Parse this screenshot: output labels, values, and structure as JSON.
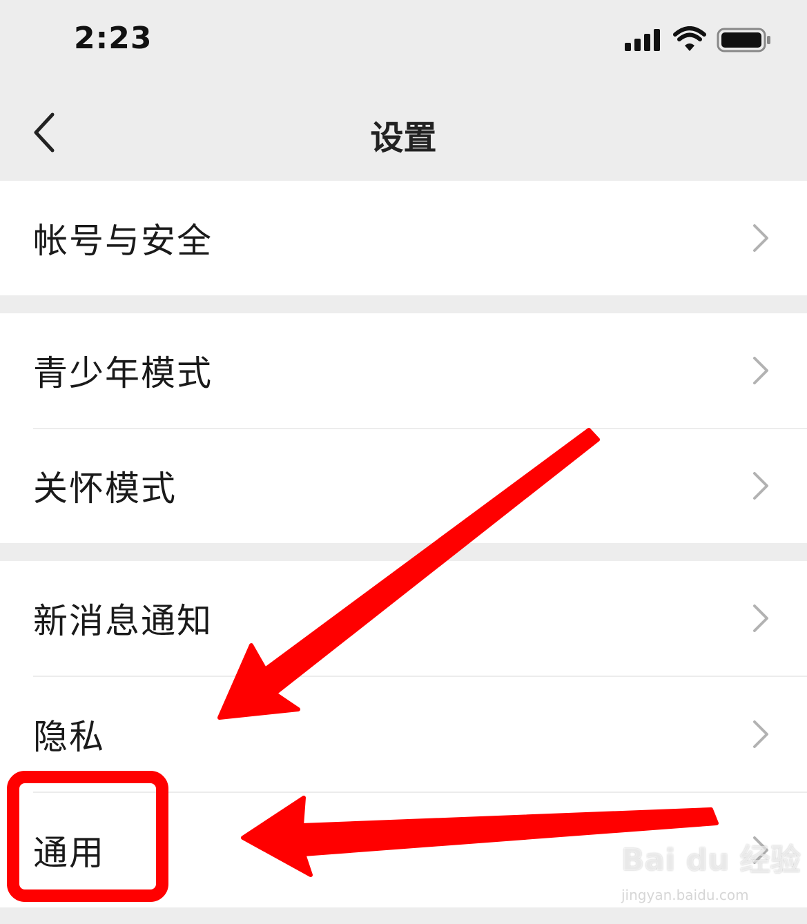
{
  "status": {
    "time": "2:23"
  },
  "nav": {
    "title": "设置"
  },
  "items": {
    "account_security": "帐号与安全",
    "youth_mode": "青少年模式",
    "care_mode": "关怀模式",
    "new_message_notification": "新消息通知",
    "privacy": "隐私",
    "general": "通用"
  },
  "watermark": {
    "brand": "Bai du 经验",
    "url": "jingyan.baidu.com"
  },
  "colors": {
    "background": "#ededed",
    "annotation": "#ff0000"
  },
  "icons": [
    "signal-icon",
    "wifi-icon",
    "battery-icon",
    "back-icon",
    "chevron-right-icon"
  ]
}
